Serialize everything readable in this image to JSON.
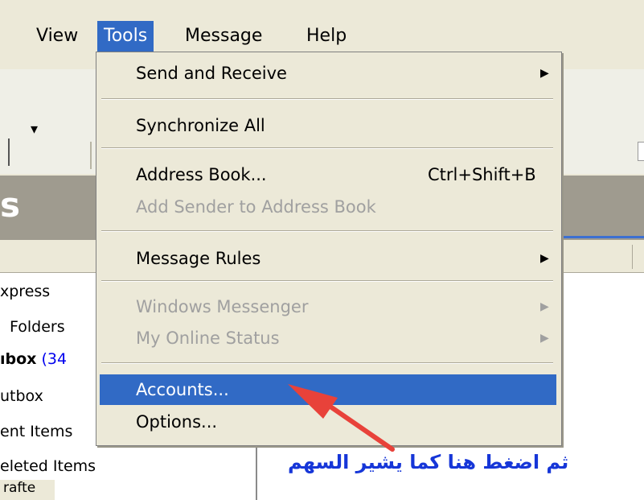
{
  "menubar": {
    "items": [
      {
        "label": "View"
      },
      {
        "label": "Tools"
      },
      {
        "label": "Message"
      },
      {
        "label": "Help"
      }
    ]
  },
  "title_band": {
    "text": "s"
  },
  "tools_menu": {
    "send_receive": "Send and Receive",
    "synchronize_all": "Synchronize All",
    "address_book": "Address Book...",
    "address_book_shortcut": "Ctrl+Shift+B",
    "add_sender": "Add Sender to Address Book",
    "message_rules": "Message Rules",
    "windows_messenger": "Windows Messenger",
    "online_status": "My Online Status",
    "accounts": "Accounts...",
    "options": "Options..."
  },
  "folders": {
    "outlook_express": "xpress",
    "local_folders": "Folders",
    "inbox_label": "ıbox",
    "inbox_count": "(34",
    "outbox": "utbox",
    "sent_items": "ent Items",
    "deleted_items": "eleted Items",
    "drafts": "rafte"
  },
  "annotation": {
    "text": "ثم اضغط هنا كما يشير السهم",
    "color": "#1636d8",
    "arrow_color": "#e8423a"
  },
  "colors": {
    "highlight": "#316ac5",
    "menu_bg": "#ece9d8",
    "band": "#9f9b8f"
  }
}
